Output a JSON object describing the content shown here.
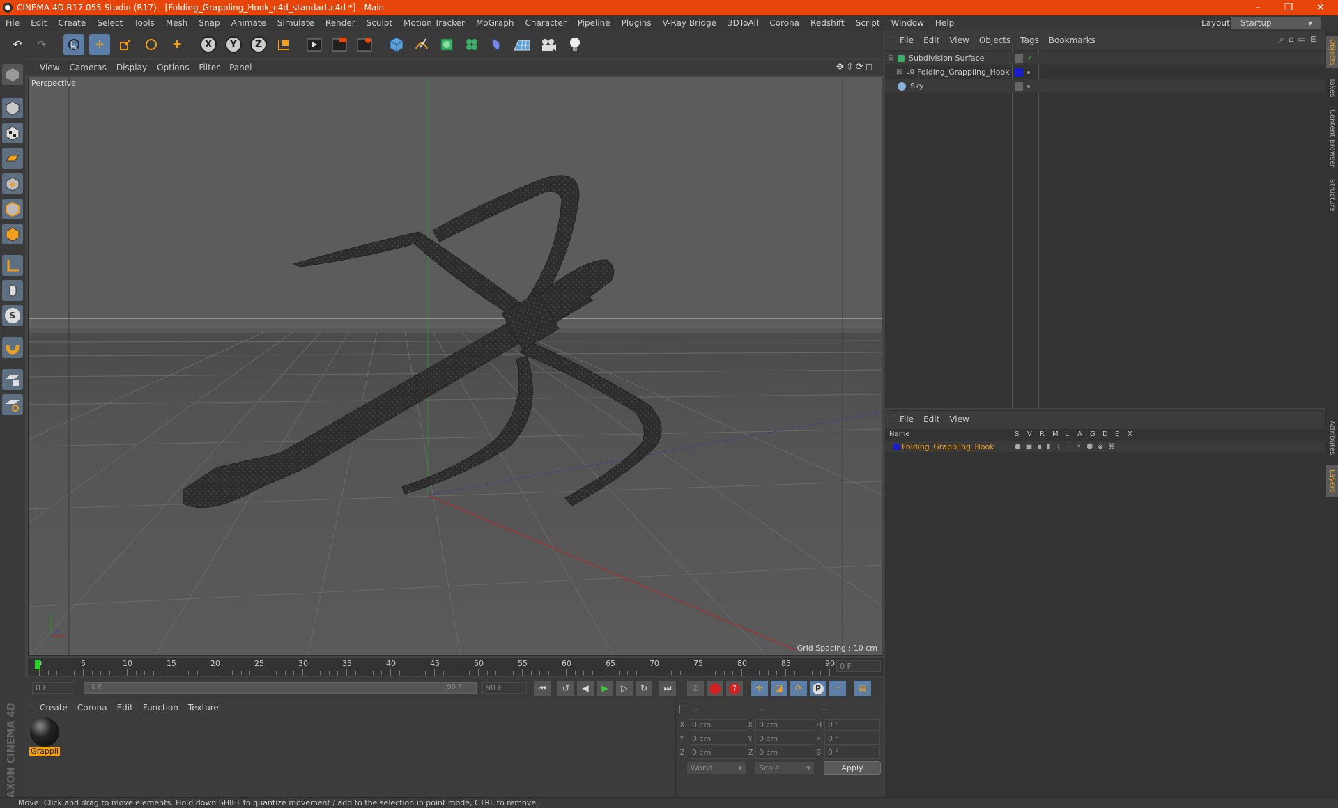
{
  "app": {
    "title": "CINEMA 4D R17.055 Studio (R17) - [Folding_Grappling_Hook_c4d_standart.c4d *] - Main"
  },
  "menu": [
    "File",
    "Edit",
    "Create",
    "Select",
    "Tools",
    "Mesh",
    "Snap",
    "Animate",
    "Simulate",
    "Render",
    "Sculpt",
    "Motion Tracker",
    "MoGraph",
    "Character",
    "Pipeline",
    "Plugins",
    "V-Ray Bridge",
    "3DToAll",
    "Corona",
    "Redshift",
    "Script",
    "Window",
    "Help"
  ],
  "layout": {
    "label": "Layout:",
    "value": "Startup"
  },
  "toolbar": {
    "x": "X",
    "y": "Y",
    "z": "Z"
  },
  "viewport": {
    "menu": [
      "View",
      "Cameras",
      "Display",
      "Options",
      "Filter",
      "Panel"
    ],
    "label": "Perspective",
    "grid_spacing": "Grid Spacing : 10 cm"
  },
  "objects_panel": {
    "menu": [
      "File",
      "Edit",
      "View",
      "Objects",
      "Tags",
      "Bookmarks"
    ],
    "items": [
      {
        "name": "Subdivision Surface"
      },
      {
        "name": "Folding_Grappling_Hook"
      },
      {
        "name": "Sky"
      }
    ]
  },
  "layers_panel": {
    "menu": [
      "File",
      "Edit",
      "View"
    ],
    "headers": [
      "Name",
      "S",
      "V",
      "R",
      "M",
      "L",
      "A",
      "G",
      "D",
      "E",
      "X"
    ],
    "row": "Folding_Grappling_Hook"
  },
  "side_tabs": [
    "Objects",
    "Takes",
    "Content Browser",
    "Structure",
    "Attributes",
    "Layers"
  ],
  "timeline": {
    "ticks": [
      "0",
      "5",
      "10",
      "15",
      "20",
      "25",
      "30",
      "35",
      "40",
      "45",
      "50",
      "55",
      "60",
      "65",
      "70",
      "75",
      "80",
      "85",
      "90"
    ],
    "current": "0 F",
    "start": "0 F",
    "range_start": "0 F",
    "range_end": "90 F",
    "end": "90 F"
  },
  "material_panel": {
    "menu": [
      "Create",
      "Corona",
      "Edit",
      "Function",
      "Texture"
    ],
    "material": "Grappli"
  },
  "coords": {
    "headers": [
      "--",
      "--",
      "--"
    ],
    "rows": [
      {
        "a": "X",
        "av": "0 cm",
        "b": "X",
        "bv": "0 cm",
        "c": "H",
        "cv": "0 °"
      },
      {
        "a": "Y",
        "av": "0 cm",
        "b": "Y",
        "bv": "0 cm",
        "c": "P",
        "cv": "0 °"
      },
      {
        "a": "Z",
        "av": "0 cm",
        "b": "Z",
        "bv": "0 cm",
        "c": "B",
        "cv": "0 °"
      }
    ],
    "mode": "World",
    "scale": "Scale",
    "apply": "Apply"
  },
  "brand": "MAXON CINEMA 4D",
  "status": "Move: Click and drag to move elements. Hold down SHIFT to quantize movement / add to the selection in point mode, CTRL to remove.",
  "colors": {
    "accent": "#e8450a",
    "selected": "#f0a020",
    "highlight": "#5b7fa8"
  }
}
